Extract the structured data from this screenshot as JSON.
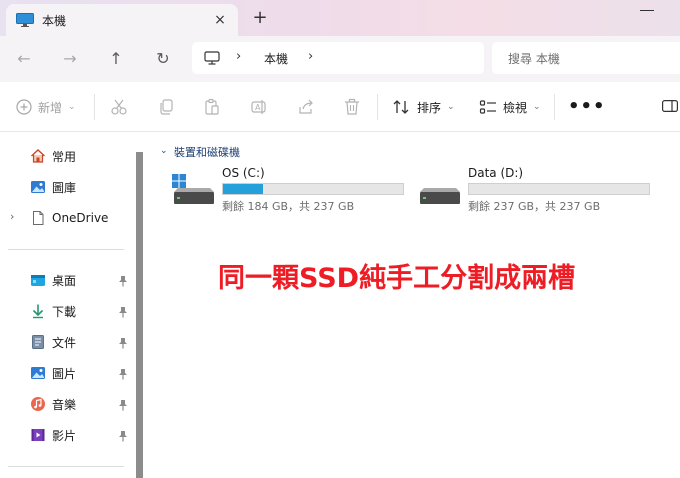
{
  "tab": {
    "title": "本機",
    "close_icon": "×",
    "add_icon": "+"
  },
  "nav": {
    "back_icon": "←",
    "forward_icon": "→",
    "up_icon": "↑",
    "refresh_icon": "↻",
    "breadcrumb_sep": "›",
    "location": "本機",
    "search_placeholder": "搜尋 本機"
  },
  "toolbar": {
    "new_label": "新增",
    "sort_label": "排序",
    "view_label": "檢視",
    "more_label": "•••",
    "chevron": "⌄"
  },
  "sidebar": {
    "items": [
      {
        "label": "常用",
        "icon": "home-icon"
      },
      {
        "label": "圖庫",
        "icon": "gallery-icon"
      },
      {
        "label": "OneDrive",
        "icon": "onedrive-file-icon"
      }
    ],
    "expand_chevron": "›",
    "pinned": [
      {
        "label": "桌面",
        "icon": "desktop-folder-icon"
      },
      {
        "label": "下載",
        "icon": "download-arrow-icon"
      },
      {
        "label": "文件",
        "icon": "document-icon"
      },
      {
        "label": "圖片",
        "icon": "pictures-icon"
      },
      {
        "label": "音樂",
        "icon": "music-icon"
      },
      {
        "label": "影片",
        "icon": "video-icon"
      }
    ]
  },
  "main": {
    "group_title": "裝置和磁碟機",
    "group_chevron": "⌄",
    "drives": [
      {
        "name": "OS (C:)",
        "free_text": "剩餘 184 GB，共 237 GB",
        "used_fraction": 0.224,
        "has_windows_logo": true
      },
      {
        "name": "Data (D:)",
        "free_text": "剩餘 237 GB，共 237 GB",
        "used_fraction": 0.0,
        "has_windows_logo": false
      }
    ]
  },
  "annotation": {
    "text": "同一顆SSD純手工分割成兩槽",
    "color": "#ee1c24"
  },
  "colors": {
    "accent": "#26a0da",
    "annotation": "#ee1c24",
    "group_title": "#1d3f73"
  }
}
